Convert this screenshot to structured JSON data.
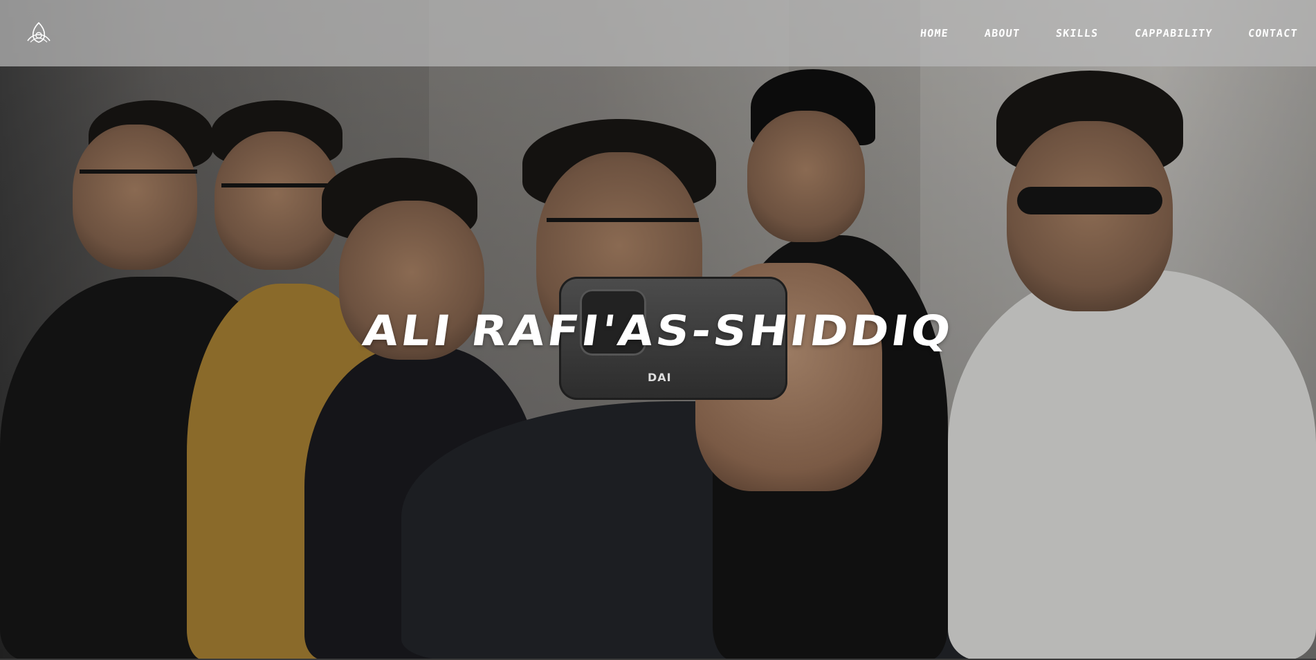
{
  "header": {
    "logo_icon": "triquetra-logo-icon",
    "nav": [
      {
        "label": "HOME"
      },
      {
        "label": "ABOUT"
      },
      {
        "label": "SKILLS"
      },
      {
        "label": "CAPPABILITY"
      },
      {
        "label": "CONTACT"
      }
    ]
  },
  "hero": {
    "title": "ALI RAFI'AS-SHIDDIQ",
    "phone_brand": "DAI"
  },
  "colors": {
    "header_bg": "#b9b9b9",
    "text": "#ffffff",
    "overlay": "#1b1b1b"
  }
}
